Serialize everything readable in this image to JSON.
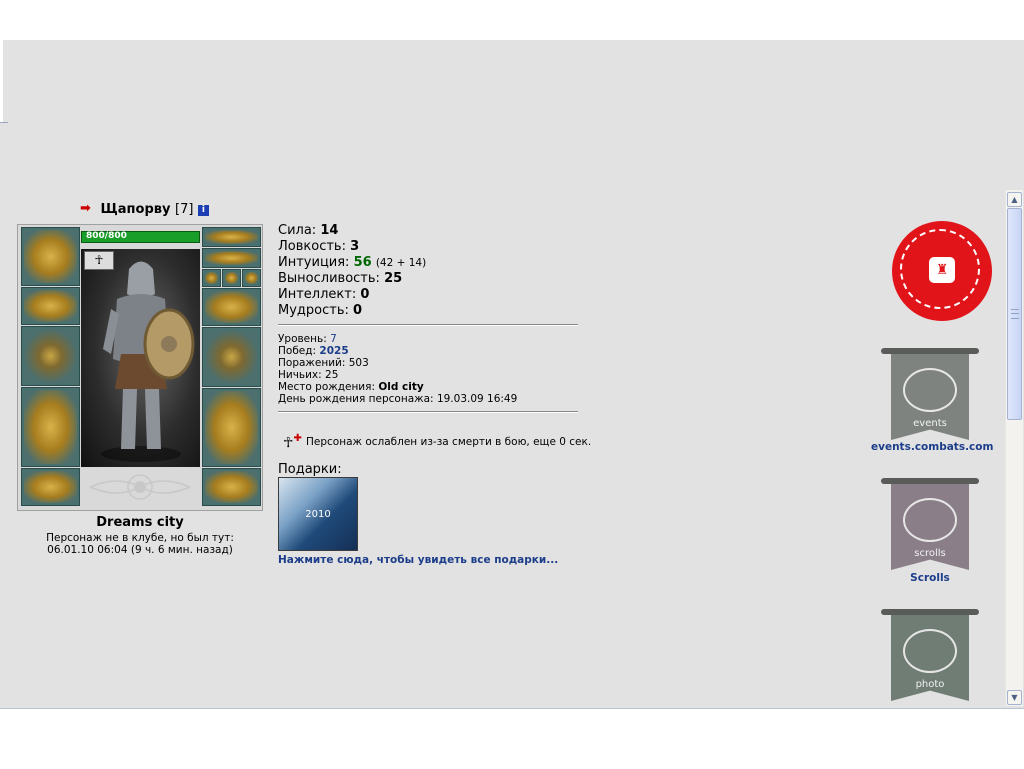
{
  "character": {
    "name": "Щапорву",
    "level": "[7]",
    "hp": "800/800",
    "city": "Dreams city",
    "club_note": "Персонаж не в клубе, но был тут:",
    "last_seen": "06.01.10 06:04 (9 ч. 6 мин. назад)"
  },
  "stats": {
    "strength": {
      "label": "Сила:",
      "value": "14"
    },
    "agility": {
      "label": "Ловкость:",
      "value": "3"
    },
    "intuition": {
      "label": "Интуиция:",
      "value": "56",
      "extra": "(42 + 14)"
    },
    "endurance": {
      "label": "Выносливость:",
      "value": "25"
    },
    "intellect": {
      "label": "Интеллект:",
      "value": "0"
    },
    "wisdom": {
      "label": "Мудрость:",
      "value": "0"
    }
  },
  "info": {
    "level": {
      "label": "Уровень:",
      "value": "7"
    },
    "wins": {
      "label": "Побед:",
      "value": "2025"
    },
    "losses": {
      "label": "Поражений:",
      "value": "503"
    },
    "draws": {
      "label": "Ничьих:",
      "value": "25"
    },
    "birthplace": {
      "label": "Место рождения:",
      "value": "Old city"
    },
    "birthday": {
      "label": "День рождения персонажа:",
      "value": "19.03.09 16:49"
    }
  },
  "weakness": "Персонаж ослаблен из-за смерти в бою, еще 0 сек.",
  "gifts": {
    "label": "Подарки:",
    "item_text": "2010",
    "link": "Нажмите сюда, чтобы увидеть все подарки..."
  },
  "banners": {
    "events_caption": "events",
    "events_link": "events.combats.com",
    "scrolls_caption": "scrolls",
    "scrolls_link": "Scrolls",
    "photo_caption": "photo"
  },
  "colors": {
    "page_bg": "#e2e2e2",
    "link_blue": "#1c3d8a",
    "hp_green": "#1a9e2a",
    "stat_green": "#006600",
    "banner_red": "#e1141a"
  },
  "icons": {
    "arrow": "arrow-right-icon",
    "info": "info-icon",
    "trauma": "trauma-icon",
    "lion": "lion-icon"
  }
}
